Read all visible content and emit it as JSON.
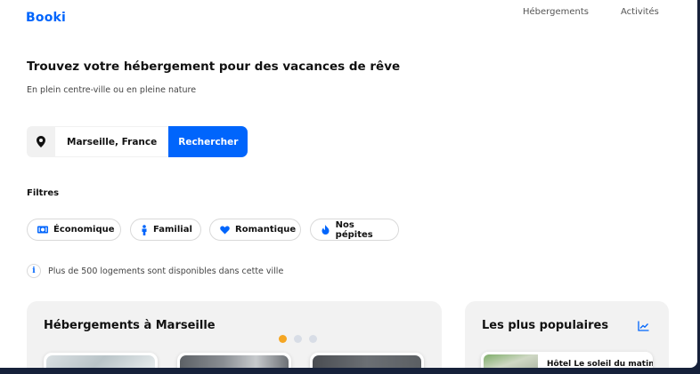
{
  "header": {
    "logo": "Booki",
    "nav": [
      "Hébergements",
      "Activités"
    ]
  },
  "hero": {
    "title": "Trouvez votre hébergement pour des vacances de rêve",
    "subtitle": "En plein centre-ville ou en pleine nature"
  },
  "search": {
    "location": "Marseille, France",
    "button_label": "Rechercher",
    "pin_icon": "map-pin-icon"
  },
  "filters": {
    "title": "Filtres",
    "items": [
      {
        "label": "Économique",
        "icon": "money-icon"
      },
      {
        "label": "Familial",
        "icon": "child-icon"
      },
      {
        "label": "Romantique",
        "icon": "heart-icon"
      },
      {
        "label": "Nos pépites",
        "icon": "flame-icon"
      }
    ]
  },
  "info": {
    "icon": "info-icon",
    "text": "Plus de 500 logements sont disponibles dans cette ville"
  },
  "accommodations": {
    "title": "Hébergements à Marseille",
    "carousel_active_index": 0,
    "carousel_count": 3
  },
  "popular": {
    "title": "Les plus populaires",
    "icon": "trend-chart-icon",
    "first_item": "Hôtel Le soleil du matin"
  },
  "colors": {
    "brand": "#0065fc",
    "accent_dot": "#f5a623",
    "panel_bg": "#f2f2f2"
  }
}
